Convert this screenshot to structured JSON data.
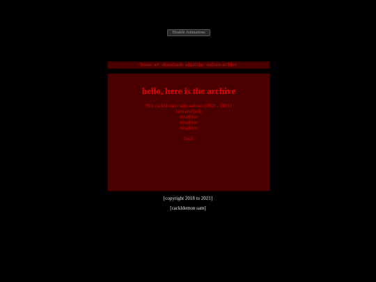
{
  "top_button": {
    "label": "Disable Animations"
  },
  "nav": {
    "items": [
      "home",
      "art",
      "downloads",
      "email me",
      "website archive"
    ]
  },
  "main": {
    "title": "hello, here is the archive",
    "links": [
      "90's cackldemon sam website (2020 - 2021)",
      "sam and jack",
      "email me",
      "email me",
      "email me"
    ],
    "back_label": "back"
  },
  "footer": {
    "copyright": "[copyright 2018 to 2021]",
    "author": "[cackldemon sam]"
  },
  "colors": {
    "background": "#000000",
    "panel": "#4b0000",
    "accent": "#e10000",
    "footer_text": "#e8e8e8"
  }
}
